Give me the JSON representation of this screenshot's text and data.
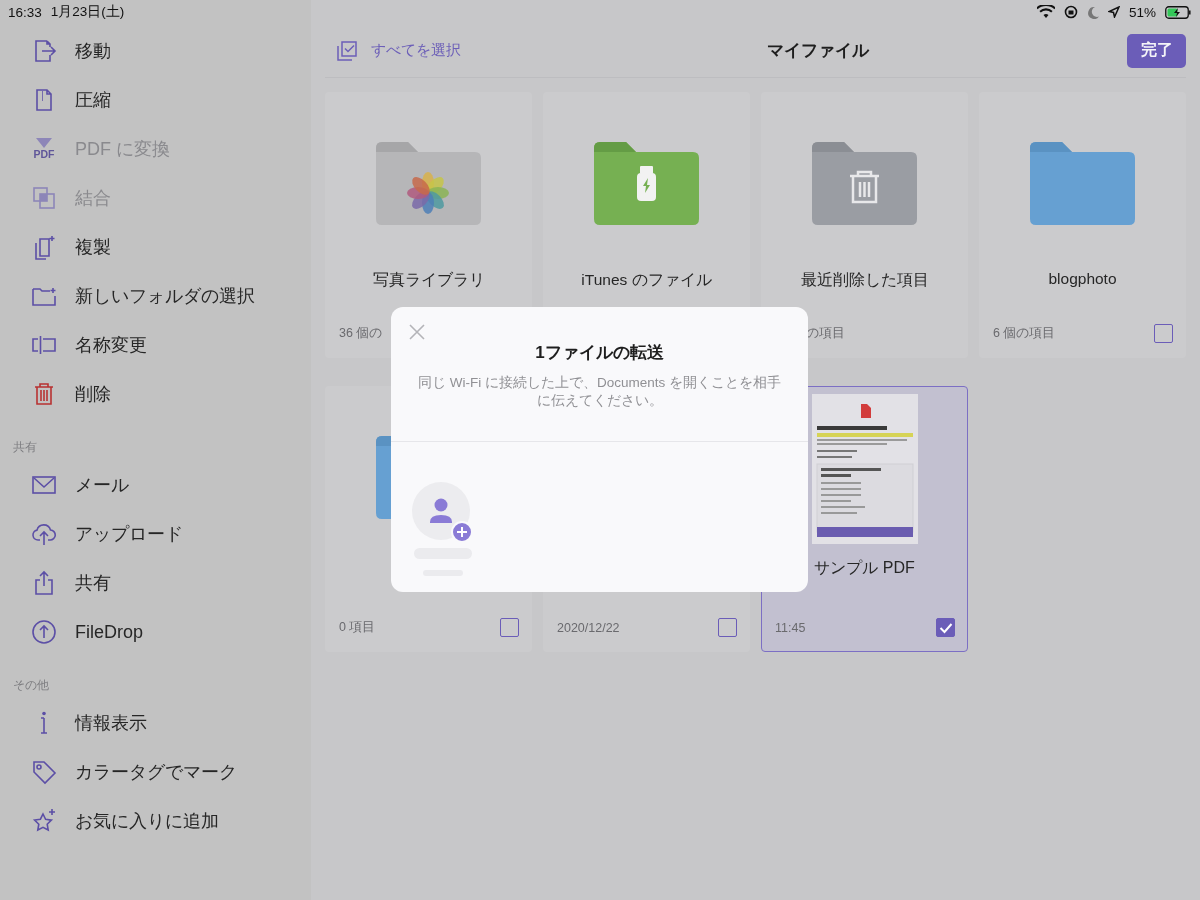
{
  "status_bar": {
    "time": "16:33",
    "date": "1月23日(土)",
    "battery": "51%"
  },
  "sidebar": {
    "sections": [
      {
        "items": [
          {
            "label": "移動",
            "disabled": false,
            "kind": "action"
          },
          {
            "label": "圧縮",
            "disabled": false,
            "kind": "action"
          },
          {
            "label": "PDF に変換",
            "icon_text": "PDF",
            "disabled": true,
            "kind": "action"
          },
          {
            "label": "結合",
            "disabled": true,
            "kind": "action"
          },
          {
            "label": "複製",
            "disabled": false,
            "kind": "action"
          },
          {
            "label": "新しいフォルダの選択",
            "disabled": false,
            "kind": "action"
          },
          {
            "label": "名称変更",
            "disabled": false,
            "kind": "action"
          },
          {
            "label": "削除",
            "disabled": false,
            "kind": "destructive"
          }
        ]
      },
      {
        "title": "共有",
        "items": [
          {
            "label": "メール",
            "disabled": false,
            "kind": "action"
          },
          {
            "label": "アップロード",
            "disabled": false,
            "kind": "action"
          },
          {
            "label": "共有",
            "disabled": false,
            "kind": "action"
          },
          {
            "label": "FileDrop",
            "disabled": false,
            "kind": "action"
          }
        ]
      },
      {
        "title": "その他",
        "items": [
          {
            "label": "情報表示",
            "disabled": false,
            "kind": "action"
          },
          {
            "label": "カラータグでマーク",
            "disabled": false,
            "kind": "action"
          },
          {
            "label": "お気に入りに追加",
            "disabled": false,
            "kind": "action"
          }
        ]
      }
    ]
  },
  "header": {
    "select_all": "すべてを選択",
    "title": "マイファイル",
    "done_button": "完了"
  },
  "files": [
    {
      "name": "写真ライブラリ",
      "meta": "36 個の",
      "kind": "photos",
      "selected": false
    },
    {
      "name": "iTunes のファイル",
      "kind": "usb",
      "selected": false
    },
    {
      "name": "最近削除した項目",
      "meta": "の項目",
      "kind": "trash",
      "selected": false
    },
    {
      "name": "blogphoto",
      "meta": "6 個の項目",
      "kind": "folder",
      "selected": false,
      "checked": false
    },
    {
      "meta": "0 項目",
      "kind": "folder",
      "selected": false,
      "checked": false
    },
    {
      "meta": "2020/12/22",
      "selected": false,
      "checked": false
    },
    {
      "name": "サンプル PDF",
      "meta": "11:45",
      "kind": "document",
      "selected": true,
      "checked": true
    }
  ],
  "dialog": {
    "title": "1ファイルの転送",
    "message": "同じ Wi-Fi に接続した上で、Documents を開くことを相手に伝えてください。"
  }
}
